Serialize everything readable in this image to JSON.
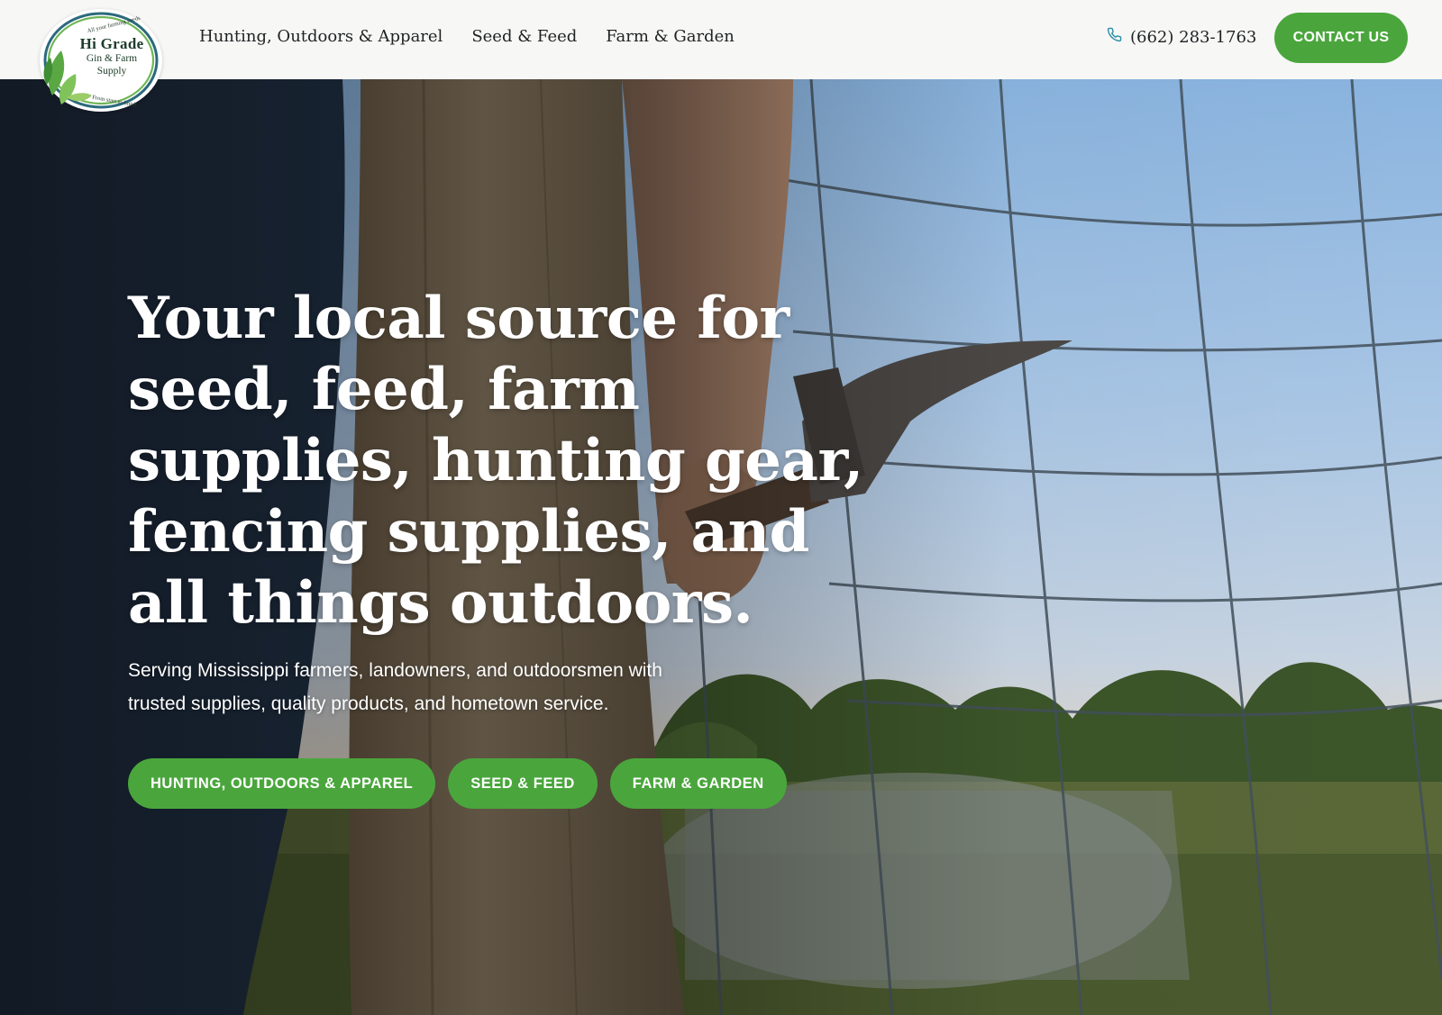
{
  "brand": {
    "name": "Hi Grade",
    "sub_line_1": "Gin & Farm",
    "sub_line_2": "Supply",
    "arc_top": "All your farming needs",
    "arc_bottom": "From start to finish",
    "accent_color": "#4aa63c"
  },
  "nav": {
    "items": [
      {
        "label": "Hunting, Outdoors & Apparel"
      },
      {
        "label": "Seed & Feed"
      },
      {
        "label": "Farm & Garden"
      }
    ]
  },
  "header": {
    "phone_icon": "phone-icon",
    "phone": "(662) 283-1763",
    "contact_label": "CONTACT US"
  },
  "hero": {
    "title": "Your local source for seed, feed, farm supplies, hunting gear, fencing supplies, and all things outdoors.",
    "subtitle": "Serving Mississippi farmers, landowners, and outdoorsmen with trusted supplies, quality products, and hometown service.",
    "buttons": [
      {
        "label": "HUNTING, OUTDOORS & APPAREL"
      },
      {
        "label": "SEED & FEED"
      },
      {
        "label": "FARM & GARDEN"
      }
    ]
  }
}
